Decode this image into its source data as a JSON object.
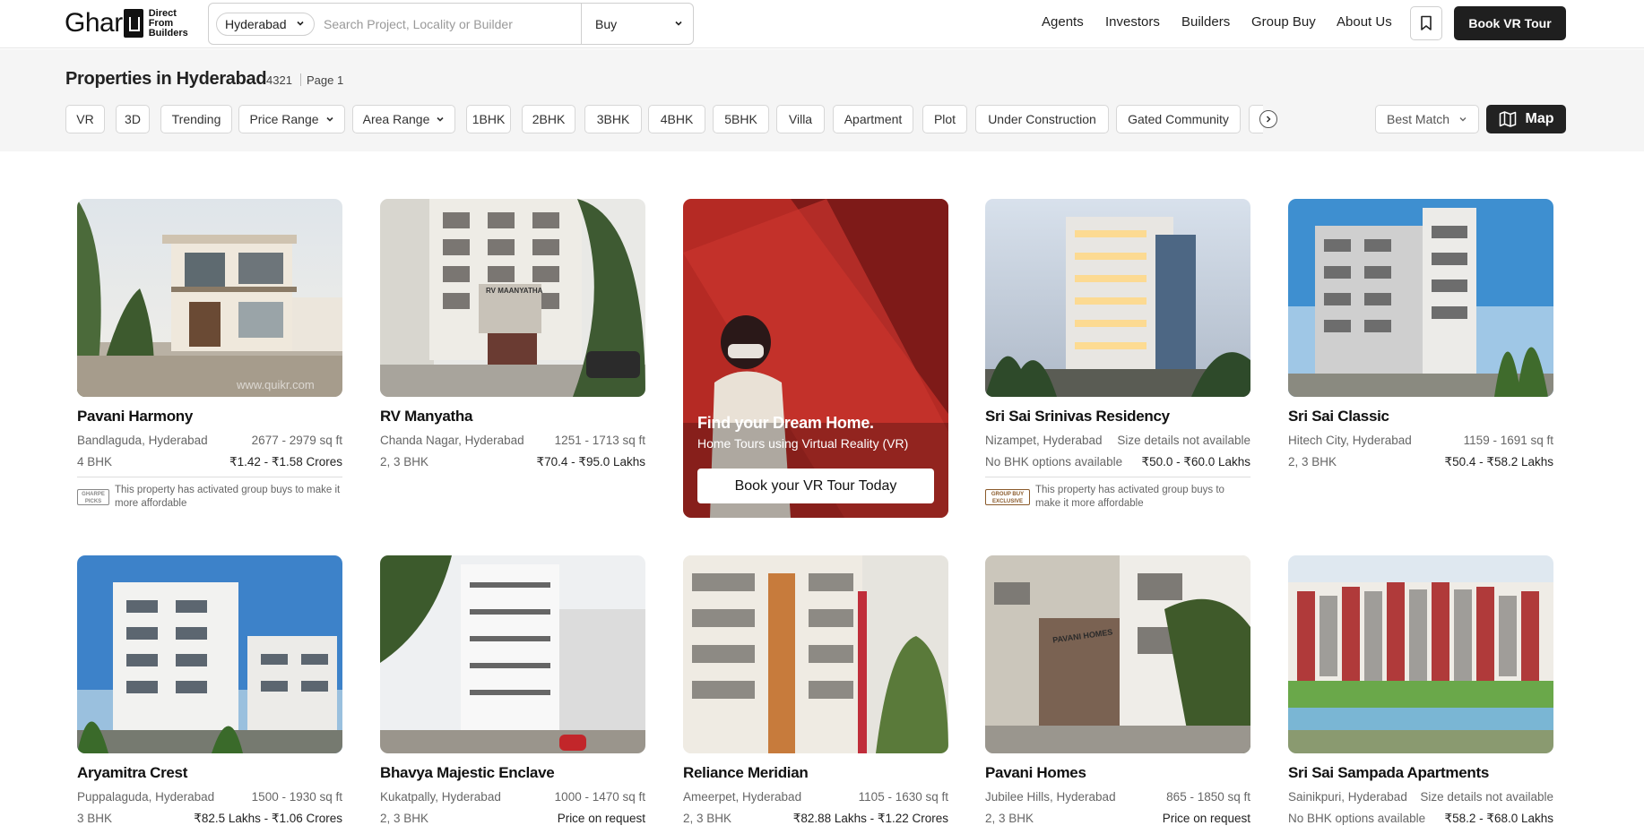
{
  "header": {
    "logo_word": "Ghar",
    "logo_tag": [
      "Direct",
      "From",
      "Builders"
    ],
    "city": "Hyderabad",
    "search_placeholder": "Search Project, Locality or Builder",
    "mode": "Buy",
    "nav": [
      "Agents",
      "Investors",
      "Builders",
      "Group Buy",
      "About Us"
    ],
    "book_vr": "Book VR Tour"
  },
  "listing": {
    "title": "Properties in Hyderabad",
    "count": "4321",
    "page": "Page 1",
    "filters": [
      "VR",
      "3D",
      "Trending",
      "Price Range",
      "Area Range",
      "1BHK",
      "2BHK",
      "3BHK",
      "4BHK",
      "5BHK",
      "Villa",
      "Apartment",
      "Plot",
      "Under Construction",
      "Gated Community"
    ],
    "sort": "Best Match",
    "map": "Map"
  },
  "promo": {
    "title": "Find your Dream Home.",
    "subtitle": "Home Tours using Virtual Reality (VR)",
    "button": "Book your VR Tour Today"
  },
  "badges": {
    "picks": [
      "GHARPE",
      "PICKS"
    ],
    "group": [
      "GROUP BUY",
      "EXCLUSIVE"
    ]
  },
  "cards": [
    {
      "name": "Pavani Harmony",
      "location": "Bandlaguda, Hyderabad",
      "size": "2677 - 2979 sq ft",
      "bhk": "4 BHK",
      "price": "₹1.42 - ₹1.58 Crores",
      "note": "This property has activated group buys to make it more affordable",
      "watermark": "www.quikr.com"
    },
    {
      "name": "RV Manyatha",
      "location": "Chanda Nagar, Hyderabad",
      "size": "1251 - 1713 sq ft",
      "bhk": "2, 3 BHK",
      "price": "₹70.4 - ₹95.0 Lakhs",
      "sign": "RV MAANYATHA"
    },
    {
      "name": "Sri Sai Srinivas Residency",
      "location": "Nizampet, Hyderabad",
      "size": "Size details not available",
      "bhk": "No BHK options available",
      "price": "₹50.0 - ₹60.0 Lakhs",
      "note": "This property has activated group buys to make it more affordable"
    },
    {
      "name": "Sri Sai Classic",
      "location": "Hitech City, Hyderabad",
      "size": "1159 - 1691 sq ft",
      "bhk": "2, 3 BHK",
      "price": "₹50.4 - ₹58.2 Lakhs"
    },
    {
      "name": "Aryamitra Crest",
      "location": "Puppalaguda, Hyderabad",
      "size": "1500 - 1930 sq ft",
      "bhk": "3 BHK",
      "price": "₹82.5 Lakhs - ₹1.06 Crores"
    },
    {
      "name": "Bhavya Majestic Enclave",
      "location": "Kukatpally, Hyderabad",
      "size": "1000 - 1470 sq ft",
      "bhk": "2, 3 BHK",
      "price": "Price on request"
    },
    {
      "name": "Reliance Meridian",
      "location": "Ameerpet, Hyderabad",
      "size": "1105 - 1630 sq ft",
      "bhk": "2, 3 BHK",
      "price": "₹82.88 Lakhs - ₹1.22 Crores"
    },
    {
      "name": "Pavani Homes",
      "location": "Jubilee Hills, Hyderabad",
      "size": "865 - 1850 sq ft",
      "bhk": "2, 3 BHK",
      "price": "Price on request",
      "sign": "PAVANI HOMES"
    },
    {
      "name": "Sri Sai Sampada Apartments",
      "location": "Sainikpuri, Hyderabad",
      "size": "Size details not available",
      "bhk": "No BHK options available",
      "price": "₹58.2 - ₹68.0 Lakhs"
    }
  ]
}
